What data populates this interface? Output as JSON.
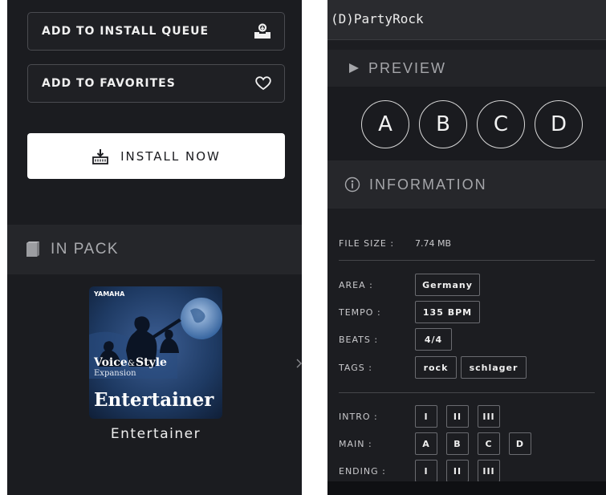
{
  "left_panel": {
    "add_to_queue_label": "ADD TO INSTALL QUEUE",
    "add_to_favorites_label": "ADD TO FAVORITES",
    "install_now_label": "INSTALL NOW",
    "in_pack_label": "IN PACK",
    "pack": {
      "cover_brand": "YAMAHA",
      "cover_line1": "Voice",
      "cover_amp": "&",
      "cover_line1b": "Style",
      "cover_line2": "Expansion",
      "cover_title": "Entertainer",
      "name": "Entertainer"
    }
  },
  "right_panel": {
    "title": "(D)PartyRock",
    "preview_label": "PREVIEW",
    "preview_buttons": [
      "A",
      "B",
      "C",
      "D"
    ],
    "information_label": "INFORMATION",
    "file_size_label": "FILE SIZE :",
    "file_size_value": "7.74 MB",
    "area_label": "AREA :",
    "area_value": "Germany",
    "tempo_label": "TEMPO :",
    "tempo_value": "135 BPM",
    "beats_label": "BEATS :",
    "beats_value": "4/4",
    "tags_label": "TAGS :",
    "tags": [
      "rock",
      "schlager"
    ],
    "intro_label": "INTRO :",
    "intro": [
      "I",
      "II",
      "III"
    ],
    "main_label": "MAIN :",
    "main": [
      "A",
      "B",
      "C",
      "D"
    ],
    "ending_label": "ENDING :",
    "ending": [
      "I",
      "II",
      "III"
    ]
  },
  "colors": {
    "panel_bg": "#1b1c20",
    "section_bg": "#25262a",
    "install_bg": "#ffffff",
    "cover_bg": "#1e3a63"
  }
}
